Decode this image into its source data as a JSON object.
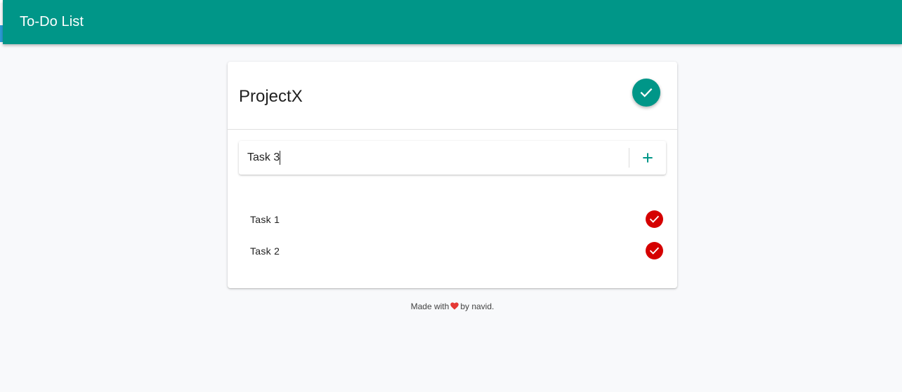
{
  "app_bar": {
    "title": "To-Do List"
  },
  "project": {
    "name": "ProjectX",
    "complete_icon": "check-icon"
  },
  "new_task": {
    "value": "Task 3",
    "add_icon": "plus-icon"
  },
  "tasks": [
    {
      "label": "Task 1",
      "icon": "check-icon"
    },
    {
      "label": "Task 2",
      "icon": "check-icon"
    }
  ],
  "footer": {
    "prefix": "Made with",
    "heart_icon": "heart-icon",
    "suffix": "by navid."
  },
  "colors": {
    "primary": "#009688",
    "done": "#d50000",
    "heart": "#e53935",
    "background": "#f8f9fb"
  }
}
